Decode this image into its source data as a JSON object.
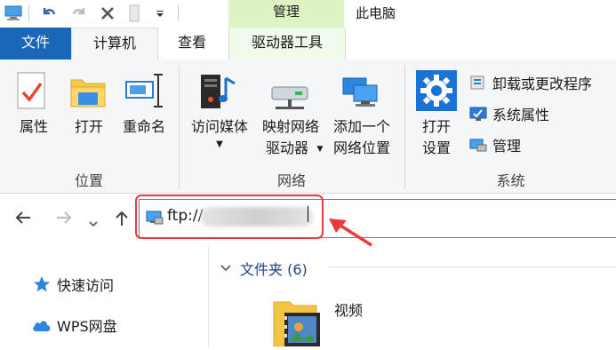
{
  "titlebar": {
    "context_tab": "管理",
    "window_title": "此电脑",
    "quick_access_icons": [
      "computer-icon",
      "undo-icon",
      "redo-icon",
      "delete-icon",
      "properties-icon",
      "dropdown-icon"
    ]
  },
  "tabs": [
    {
      "label": "文件",
      "active": false
    },
    {
      "label": "计算机",
      "active": true
    },
    {
      "label": "查看",
      "active": false
    },
    {
      "label": "驱动器工具",
      "active": false
    }
  ],
  "ribbon": {
    "location": {
      "group_label": "位置",
      "properties": "属性",
      "open": "打开",
      "rename": "重命名"
    },
    "network": {
      "group_label": "网络",
      "media_line1": "访问媒体",
      "map_line1": "映射网络",
      "map_line2": "驱动器",
      "add_line1": "添加一个",
      "add_line2": "网络位置"
    },
    "system": {
      "group_label": "系统",
      "open_settings_line1": "打开",
      "open_settings_line2": "设置",
      "uninstall": "卸载或更改程序",
      "system_properties": "系统属性",
      "manage": "管理"
    }
  },
  "address": {
    "value": "ftp://"
  },
  "navpane": {
    "items": [
      {
        "label": "快速访问",
        "icon": "star-icon"
      },
      {
        "label": "WPS网盘",
        "icon": "cloud-icon"
      }
    ]
  },
  "content": {
    "section_title": "文件夹 (6)",
    "items": [
      {
        "label": "视频",
        "icon": "video-folder-icon"
      }
    ]
  },
  "colors": {
    "file_tab": "#1a66b8",
    "context_tab": "#ddf3c4",
    "highlight": "#e83b3b",
    "section_header": "#1e3f8c"
  }
}
